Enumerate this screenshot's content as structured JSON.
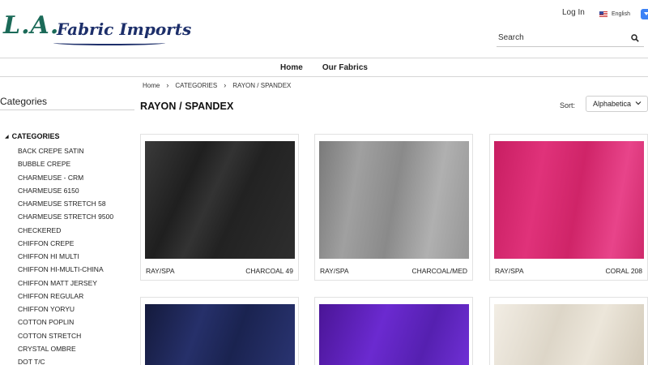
{
  "logo": {
    "big": "L.A.",
    "small": "Fabric Imports"
  },
  "header": {
    "login": "Log In",
    "language": "English"
  },
  "search": {
    "placeholder": "Search"
  },
  "nav": {
    "items": [
      "Home",
      "Our Fabrics"
    ]
  },
  "breadcrumb": {
    "items": [
      "Home",
      "CATEGORIES",
      "RAYON / SPANDEX"
    ]
  },
  "sidebar": {
    "title": "Categories",
    "root": "CATEGORIES",
    "items": [
      "BACK CREPE SATIN",
      "BUBBLE CREPE",
      "CHARMEUSE - CRM",
      "CHARMEUSE 6150",
      "CHARMEUSE STRETCH 58",
      "CHARMEUSE STRETCH 9500",
      "CHECKERED",
      "CHIFFON CREPE",
      "CHIFFON HI MULTI",
      "CHIFFON HI-MULTI-CHINA",
      "CHIFFON MATT JERSEY",
      "CHIFFON REGULAR",
      "CHIFFON YORYU",
      "COTTON POPLIN",
      "COTTON STRETCH",
      "CRYSTAL OMBRE",
      "DOT T/C"
    ]
  },
  "main": {
    "title": "RAYON / SPANDEX",
    "sort_label": "Sort:",
    "sort_value": "Alphabetica"
  },
  "products": [
    {
      "type": "RAY/SPA",
      "name": "CHARCOAL 49",
      "color": "#2b2b2b"
    },
    {
      "type": "RAY/SPA",
      "name": "CHARCOAL/MED",
      "color": "#8f8f8f"
    },
    {
      "type": "RAY/SPA",
      "name": "CORAL 208",
      "color": "#d6286f"
    },
    {
      "type": "",
      "name": "",
      "color": "#1c2550"
    },
    {
      "type": "",
      "name": "",
      "color": "#5a1fb0"
    },
    {
      "type": "",
      "name": "",
      "color": "#e8e2d6"
    }
  ]
}
